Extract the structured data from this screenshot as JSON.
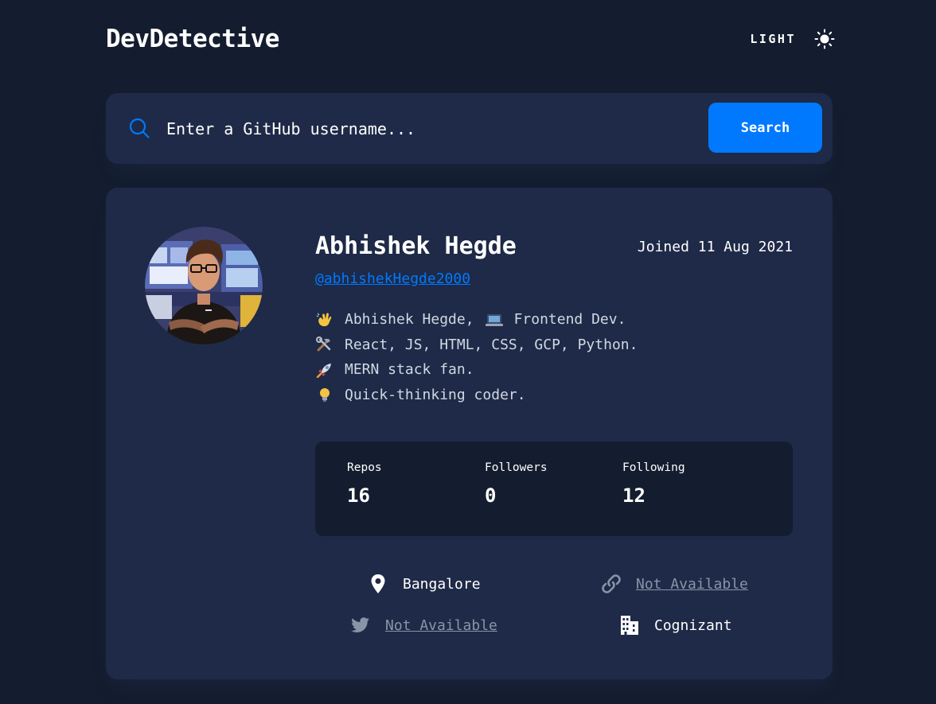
{
  "header": {
    "logo": "DevDetective",
    "theme_label": "LIGHT"
  },
  "search": {
    "placeholder": "Enter a GitHub username...",
    "value": "",
    "button_label": "Search"
  },
  "profile": {
    "name": "Abhishek Hegde",
    "username": "@abhishekHegde2000",
    "joined": "Joined 11 Aug 2021",
    "bio": [
      {
        "emoji": "waving-hand-icon",
        "text": "Abhishek Hegde,"
      },
      {
        "emoji": "laptop-icon",
        "text": "Frontend Dev."
      },
      {
        "emoji": "tools-icon",
        "text": "React, JS, HTML, CSS, GCP, Python."
      },
      {
        "emoji": "rocket-icon",
        "text": "MERN stack fan."
      },
      {
        "emoji": "lightbulb-icon",
        "text": "Quick-thinking coder."
      }
    ]
  },
  "stats": {
    "repos_label": "Repos",
    "repos_value": "16",
    "followers_label": "Followers",
    "followers_value": "0",
    "following_label": "Following",
    "following_value": "12"
  },
  "links": {
    "location": "Bangalore",
    "website": "Not Available",
    "twitter": "Not Available",
    "company": "Cognizant"
  },
  "colors": {
    "background": "#141d2f",
    "card": "#1e2a47",
    "accent": "#0079ff",
    "muted": "#8a94a8"
  }
}
